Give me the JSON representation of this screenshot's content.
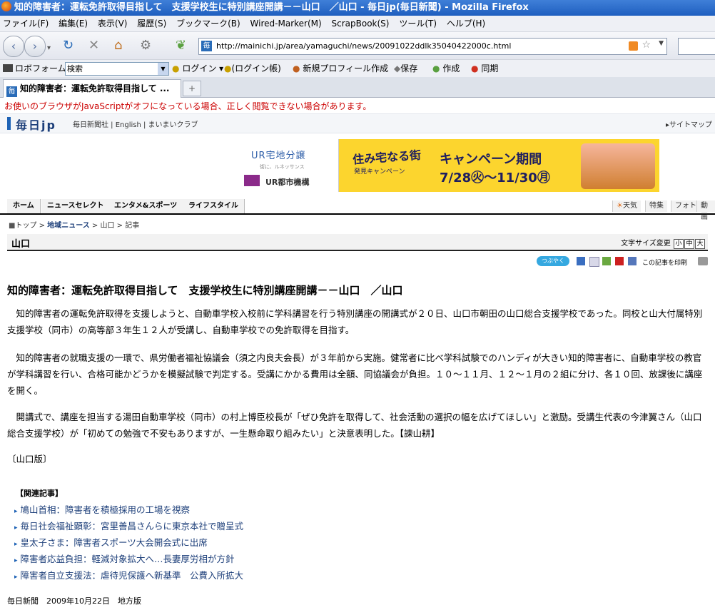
{
  "window": {
    "title": "知的障害者：運転免許取得目指して　支援学校生に特別講座開講－－山口　／山口 - 毎日jp(毎日新聞) - Mozilla Firefox"
  },
  "menu": {
    "items": [
      "ファイル(F)",
      "編集(E)",
      "表示(V)",
      "履歴(S)",
      "ブックマーク(B)",
      "Wired-Marker(M)",
      "ScrapBook(S)",
      "ツール(T)",
      "ヘルプ(H)"
    ]
  },
  "navbar": {
    "url": "http://mainichi.jp/area/yamaguchi/news/20091022ddlk35040422000c.html",
    "favicon_text": "毎"
  },
  "bookmarks": {
    "roboform": "ロボフォーム",
    "search_select": "検索",
    "login": "ログイン",
    "login_list": "(ログイン帳)",
    "new_profile": "新規プロフィール作成",
    "save": "保存",
    "create": "作成",
    "sync": "同期"
  },
  "tab": {
    "label": "知的障害者：運転免許取得目指して ..."
  },
  "page": {
    "warning": "お使いのブラウザがJavaScriptがオフになっている場合、正しく閲覧できない場合があります。",
    "logo": "毎日jp",
    "top_links": "毎日新聞社 | English | まいまいクラブ",
    "sitemap": "サイトマップ",
    "banner": {
      "left_title": "UR宅地分譲",
      "left_sub": "街に、ルネッサンス",
      "left_org": "UR都市機構",
      "campaign_title": "住み宅なる街",
      "campaign_sub": "発見キャンペーン",
      "period_label": "キャンペーン期間",
      "period_dates": "7/28㊋～11/30㊊"
    },
    "gnav": [
      "ホーム",
      "ニュースセレクト",
      "エンタメ&スポーツ",
      "ライフスタイル"
    ],
    "gnav_sub": [
      "天気",
      "特集",
      "フォト",
      "動画"
    ],
    "breadcrumb": {
      "top": "トップ",
      "local": "地域ニュース",
      "region": "山口",
      "article": "記事"
    },
    "region_name": "山口",
    "font_size": {
      "label": "文字サイズ変更",
      "small": "小",
      "medium": "中",
      "large": "大"
    },
    "share": {
      "twitter": "つぶやく",
      "print": "この記事を印刷"
    },
    "headline": "知的障害者：運転免許取得目指して　支援学校生に特別講座開講－－山口　／山口",
    "paragraphs": [
      "　知的障害者の運転免許取得を支援しようと、自動車学校入校前に学科講習を行う特別講座の開講式が２０日、山口市朝田の山口総合支援学校であった。同校と山大付属特別支援学校（同市）の高等部３年生１２人が受講し、自動車学校での免許取得を目指す。",
      "　知的障害者の就職支援の一環で、県労働者福祉協議会（須之内良夫会長）が３年前から実施。健常者に比べ学科試験でのハンディが大きい知的障害者に、自動車学校の教官が学科講習を行い、合格可能かどうかを模擬試験で判定する。受講にかかる費用は全額、同協議会が負担。１０～１１月、１２～１月の２組に分け、各１０回、放課後に講座を開く。",
      "　開講式で、講座を担当する湯田自動車学校（同市）の村上博臣校長が「ぜひ免許を取得して、社会活動の選択の幅を広げてほしい」と激励。受講生代表の今津翼さん（山口総合支援学校）が「初めての勉強で不安もありますが、一生懸命取り組みたい」と決意表明した。【諫山耕】"
    ],
    "edition": "〔山口版〕",
    "related_heading": "【関連記事】",
    "related": [
      "鳩山首相：障害者を積極採用の工場を視察",
      "毎日社会福祉顕彰：宮里善昌さんらに東京本社で贈呈式",
      "皇太子さま：障害者スポーツ大会開会式に出席",
      "障害者応益負担：軽減対象拡大へ…長妻厚労相が方針",
      "障害者自立支援法：虐待児保護へ新基準　公費入所拡大"
    ],
    "footer": "毎日新聞　2009年10月22日　地方版"
  }
}
